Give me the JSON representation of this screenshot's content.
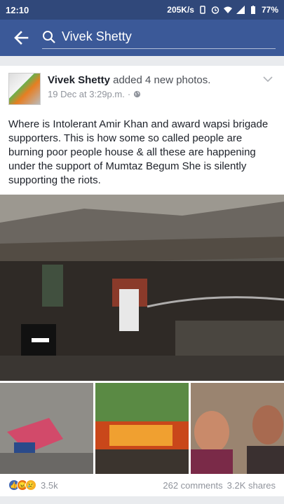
{
  "status_bar": {
    "time": "12:10",
    "speed": "205K/s",
    "battery": "77%"
  },
  "search": {
    "query": "Vivek Shetty"
  },
  "post": {
    "author": "Vivek Shetty",
    "action": "added 4 new photos.",
    "timestamp": "19 Dec at 3:29p.m.",
    "separator": "·",
    "body": "Where is Intolerant Amir Khan and award wapsi brigade supporters. This is how some so called people are burning poor people house & all these are happening under the support of Mumtaz Begum She is silently supporting the riots.",
    "reaction_count": "3.5k",
    "comments": "262 comments",
    "shares": "3.2K shares"
  },
  "colors": {
    "header": "#3b5998",
    "status_bar": "#30487a"
  }
}
